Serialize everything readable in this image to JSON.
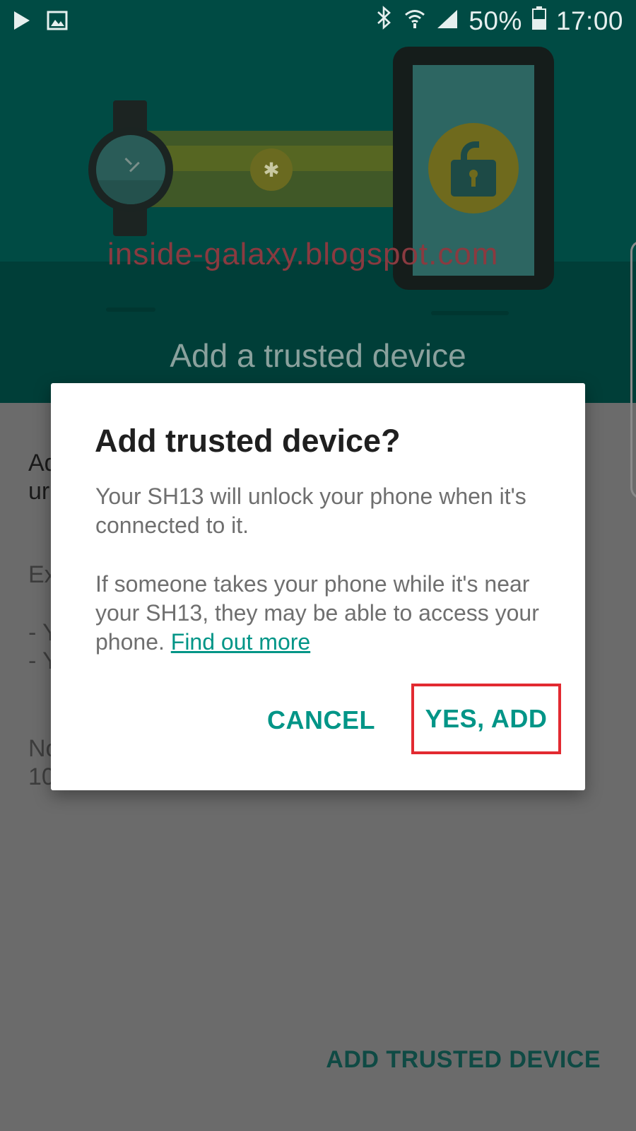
{
  "status_bar": {
    "battery": "50%",
    "time": "17:00",
    "icons": [
      "play-store-icon",
      "image-icon",
      "bluetooth-icon",
      "wifi-icon",
      "signal-icon",
      "battery-icon"
    ]
  },
  "header": {
    "watermark": "inside-galaxy.blogspot.com",
    "title": "Add a trusted device"
  },
  "background": {
    "line1a": "Ad",
    "line1b": "ur",
    "line2": "Ex",
    "bullet1": "- Y",
    "bullet2": "- Y",
    "line3a": "No",
    "line3b": "10",
    "bottom_button": "ADD TRUSTED DEVICE"
  },
  "dialog": {
    "title": "Add trusted device?",
    "paragraph1": "Your SH13 will unlock your phone when it's connected to it.",
    "paragraph2": "If someone takes your phone while it's near your SH13, they may be able to access your phone.",
    "link": "Find out more",
    "cancel_label": "CANCEL",
    "confirm_label": "YES, ADD"
  },
  "colors": {
    "accent": "#009587",
    "highlight_box": "#e22a31",
    "header_bg": "#004b44",
    "scrim": "#6b6b6b"
  }
}
